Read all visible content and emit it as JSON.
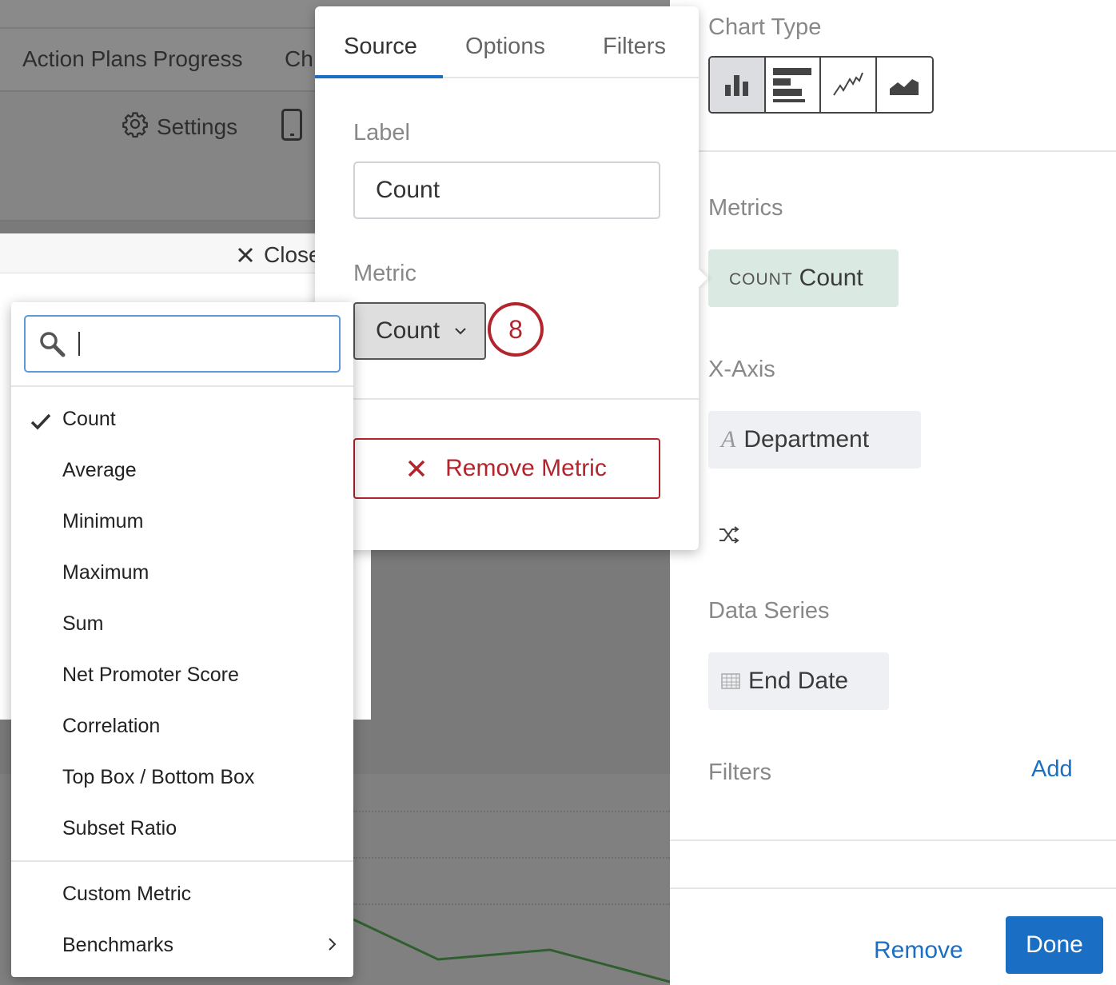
{
  "background": {
    "tabs": [
      "Action Plans Progress",
      "Ch"
    ],
    "settings_label": "Settings",
    "close_label": "Close"
  },
  "sidebar": {
    "chart_type_label": "Chart Type",
    "chart_types": [
      "bar-chart-icon",
      "horizontal-bar-chart-icon",
      "line-chart-icon",
      "area-chart-icon"
    ],
    "chart_type_selected": "bar-chart-icon",
    "metrics_label": "Metrics",
    "metric_pill": {
      "type": "COUNT",
      "label": "Count"
    },
    "x_axis_label": "X-Axis",
    "x_axis_pill": "Department",
    "data_series_label": "Data Series",
    "data_series_pill": "End Date",
    "filters_label": "Filters",
    "filters_add": "Add",
    "remove_label": "Remove",
    "done_label": "Done"
  },
  "popover": {
    "tabs": [
      "Source",
      "Options",
      "Filters"
    ],
    "active_tab": "Source",
    "label_heading": "Label",
    "label_value": "Count",
    "metric_heading": "Metric",
    "metric_value": "Count",
    "step_number": "8",
    "remove_metric_label": "Remove Metric"
  },
  "dropdown": {
    "search_value": "",
    "items": [
      "Count",
      "Average",
      "Minimum",
      "Maximum",
      "Sum",
      "Net Promoter Score",
      "Correlation",
      "Top Box / Bottom Box",
      "Subset Ratio"
    ],
    "selected": "Count",
    "extra_items": [
      "Custom Metric",
      "Benchmarks"
    ]
  },
  "colors": {
    "accent": "#1a6fc4",
    "danger": "#b3242d",
    "metric_pill_bg": "#dbe9e3",
    "pill_bg": "#eef0f3",
    "line_series": "#2f5f2f"
  }
}
